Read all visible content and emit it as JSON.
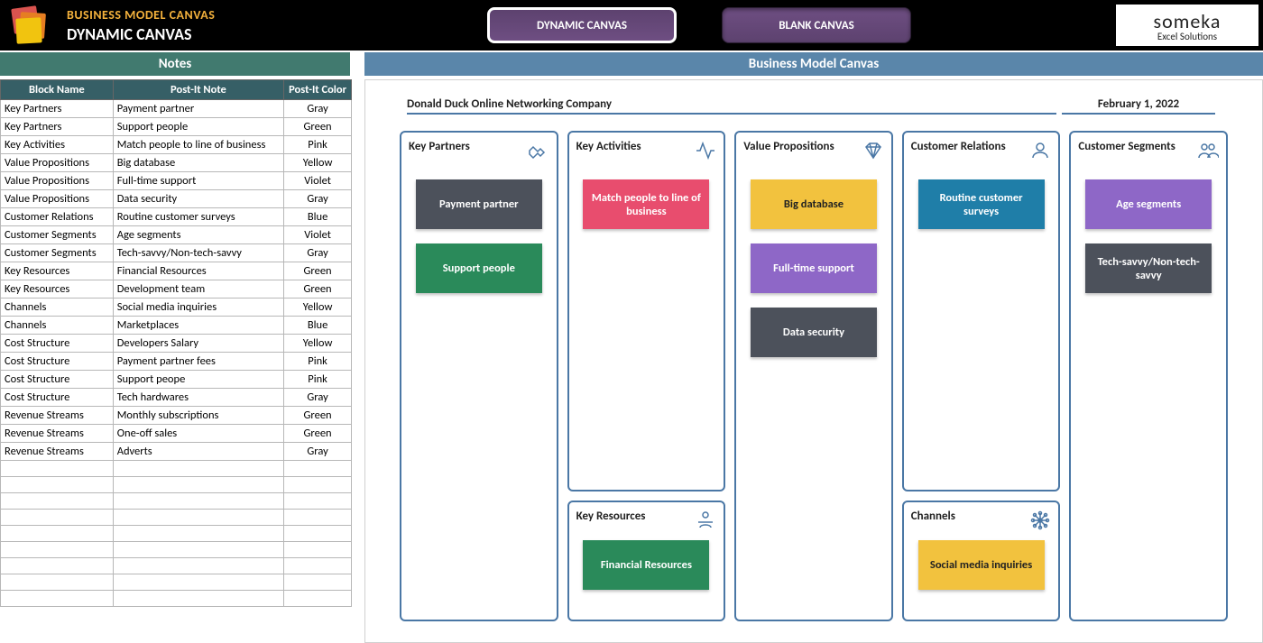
{
  "header": {
    "title": "BUSINESS MODEL CANVAS",
    "subtitle": "DYNAMIC CANVAS",
    "nav_dynamic": "DYNAMIC CANVAS",
    "nav_blank": "BLANK CANVAS",
    "brand_main": "someka",
    "brand_sub": "Excel Solutions"
  },
  "section": {
    "notes": "Notes",
    "canvas": "Business Model Canvas"
  },
  "notes": {
    "cols": {
      "c1": "Block Name",
      "c2": "Post-It Note",
      "c3": "Post-It Color"
    },
    "rows": [
      {
        "block": "Key Partners",
        "note": "Payment partner",
        "color": "Gray"
      },
      {
        "block": "Key Partners",
        "note": "Support people",
        "color": "Green"
      },
      {
        "block": "Key Activities",
        "note": "Match people to line of business",
        "color": "Pink"
      },
      {
        "block": "Value Propositions",
        "note": "Big database",
        "color": "Yellow"
      },
      {
        "block": "Value Propositions",
        "note": "Full-time support",
        "color": "Violet"
      },
      {
        "block": "Value Propositions",
        "note": "Data security",
        "color": "Gray"
      },
      {
        "block": "Customer Relations",
        "note": "Routine customer surveys",
        "color": "Blue"
      },
      {
        "block": "Customer Segments",
        "note": "Age segments",
        "color": "Violet"
      },
      {
        "block": "Customer Segments",
        "note": "Tech-savvy/Non-tech-savvy",
        "color": "Gray"
      },
      {
        "block": "Key Resources",
        "note": "Financial Resources",
        "color": "Green"
      },
      {
        "block": "Key Resources",
        "note": "Development team",
        "color": "Green"
      },
      {
        "block": "Channels",
        "note": "Social media inquiries",
        "color": "Yellow"
      },
      {
        "block": "Channels",
        "note": "Marketplaces",
        "color": "Blue"
      },
      {
        "block": "Cost Structure",
        "note": "Developers Salary",
        "color": "Yellow"
      },
      {
        "block": "Cost Structure",
        "note": "Payment partner fees",
        "color": "Pink"
      },
      {
        "block": "Cost Structure",
        "note": "Support peope",
        "color": "Pink"
      },
      {
        "block": "Cost Structure",
        "note": "Tech hardwares",
        "color": "Gray"
      },
      {
        "block": "Revenue Streams",
        "note": "Monthly subscriptions",
        "color": "Green"
      },
      {
        "block": "Revenue Streams",
        "note": "One-off sales",
        "color": "Green"
      },
      {
        "block": "Revenue Streams",
        "note": "Adverts",
        "color": "Gray"
      }
    ],
    "blank_rows": 9
  },
  "canvas": {
    "company": "Donald Duck Online Networking Company",
    "date": "February 1, 2022",
    "blocks": {
      "key_partners": {
        "title": "Key Partners",
        "cards": [
          {
            "t": "Payment partner",
            "c": "c-gray"
          },
          {
            "t": "Support people",
            "c": "c-green"
          }
        ]
      },
      "key_activities": {
        "title": "Key Activities",
        "cards": [
          {
            "t": "Match people to line of business",
            "c": "c-pink"
          }
        ]
      },
      "key_resources": {
        "title": "Key Resources",
        "cards": [
          {
            "t": "Financial Resources",
            "c": "c-green"
          }
        ]
      },
      "value_propositions": {
        "title": "Value Propositions",
        "cards": [
          {
            "t": "Big database",
            "c": "c-yellow"
          },
          {
            "t": "Full-time support",
            "c": "c-violet"
          },
          {
            "t": "Data security",
            "c": "c-gray"
          }
        ]
      },
      "customer_relations": {
        "title": "Customer Relations",
        "cards": [
          {
            "t": "Routine customer surveys",
            "c": "c-blue"
          }
        ]
      },
      "channels": {
        "title": "Channels",
        "cards": [
          {
            "t": "Social media inquiries",
            "c": "c-yellow"
          }
        ]
      },
      "customer_segments": {
        "title": "Customer Segments",
        "cards": [
          {
            "t": "Age segments",
            "c": "c-violet"
          },
          {
            "t": "Tech-savvy/Non-tech-savvy",
            "c": "c-gray"
          }
        ]
      }
    }
  }
}
